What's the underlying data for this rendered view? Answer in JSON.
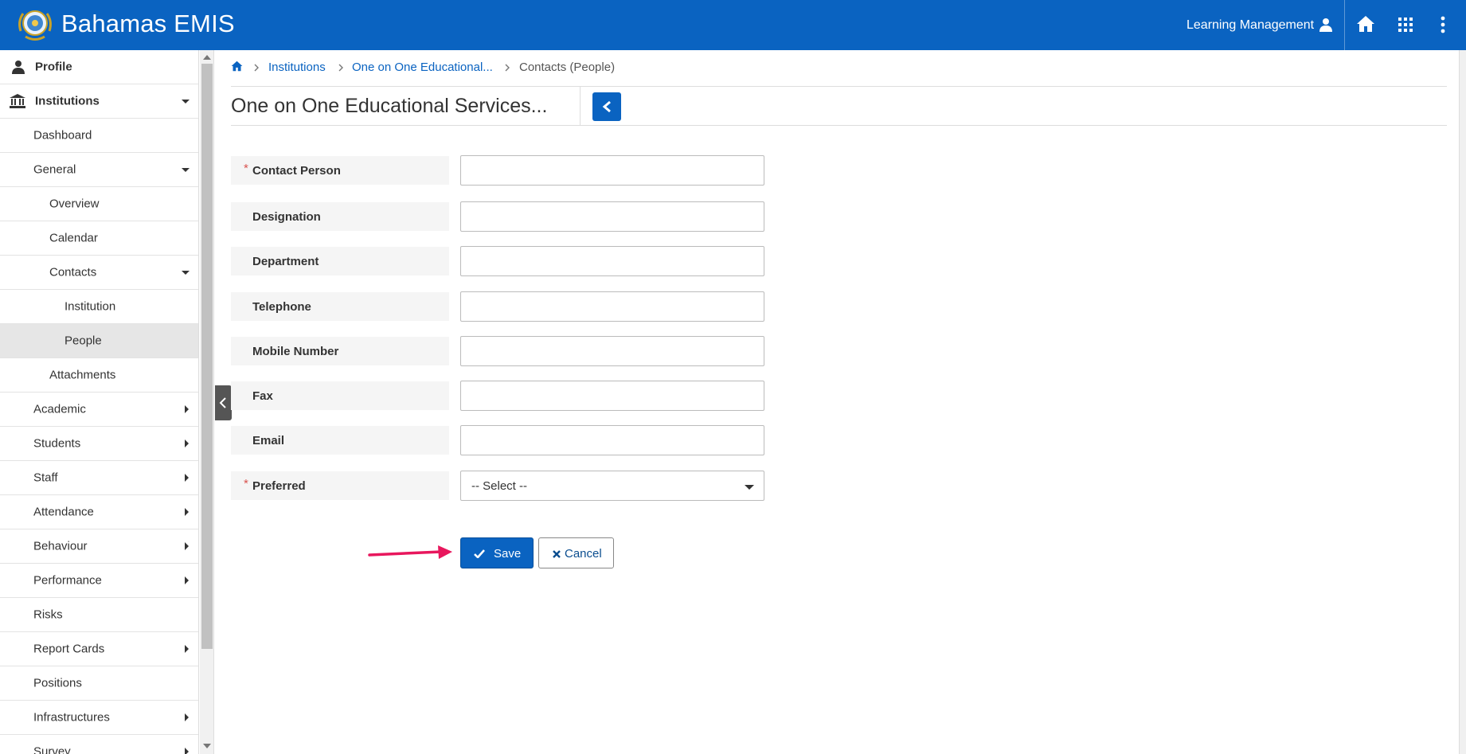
{
  "header": {
    "app_title": "Bahamas EMIS",
    "user_label": "Learning Management",
    "brand_color": "#0a63c1"
  },
  "sidebar": {
    "items": [
      {
        "label": "Profile",
        "icon": "user-icon"
      },
      {
        "label": "Institutions",
        "icon": "institution-icon"
      },
      {
        "label": "Dashboard"
      },
      {
        "label": "General"
      },
      {
        "label": "Overview"
      },
      {
        "label": "Calendar"
      },
      {
        "label": "Contacts"
      },
      {
        "label": "Institution"
      },
      {
        "label": "People",
        "active": true
      },
      {
        "label": "Attachments"
      },
      {
        "label": "Academic"
      },
      {
        "label": "Students"
      },
      {
        "label": "Staff"
      },
      {
        "label": "Attendance"
      },
      {
        "label": "Behaviour"
      },
      {
        "label": "Performance"
      },
      {
        "label": "Risks"
      },
      {
        "label": "Report Cards"
      },
      {
        "label": "Positions"
      },
      {
        "label": "Infrastructures"
      },
      {
        "label": "Survey"
      }
    ]
  },
  "breadcrumb": {
    "items": [
      "Institutions",
      "One on One Educational...",
      "Contacts (People)"
    ]
  },
  "page": {
    "title": "One on One Educational Services..."
  },
  "form": {
    "fields": [
      {
        "label": "Contact Person",
        "required": true,
        "value": ""
      },
      {
        "label": "Designation",
        "required": false,
        "value": ""
      },
      {
        "label": "Department",
        "required": false,
        "value": ""
      },
      {
        "label": "Telephone",
        "required": false,
        "value": ""
      },
      {
        "label": "Mobile Number",
        "required": false,
        "value": ""
      },
      {
        "label": "Fax",
        "required": false,
        "value": ""
      },
      {
        "label": "Email",
        "required": false,
        "value": ""
      },
      {
        "label": "Preferred",
        "required": true,
        "selected": "-- Select --"
      }
    ],
    "required_mark": "*",
    "save_label": "Save",
    "cancel_label": "Cancel"
  }
}
